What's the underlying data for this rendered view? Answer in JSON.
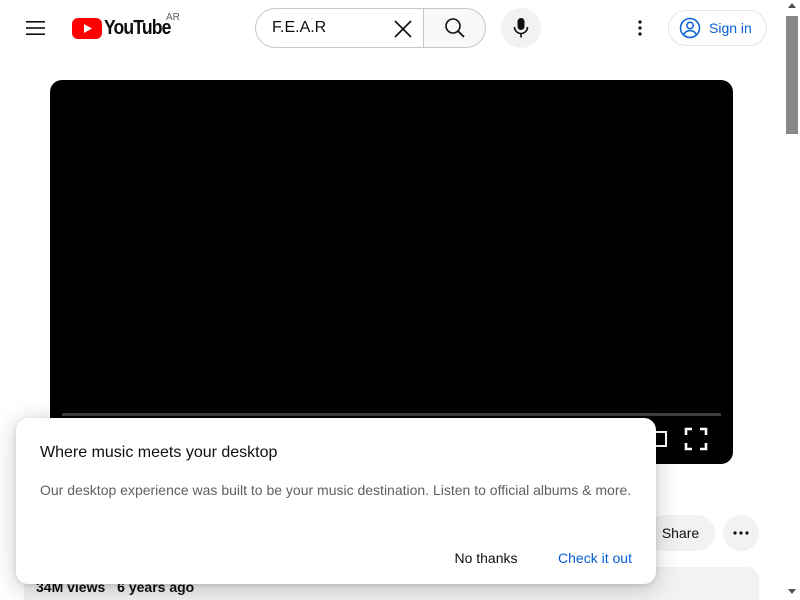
{
  "header": {
    "logo_text": "YouTube",
    "region_code": "AR",
    "search": {
      "value": "F.E.A.R",
      "placeholder": "Search"
    },
    "sign_in_label": "Sign in",
    "icons": {
      "menu": "hamburger-menu-icon",
      "clear": "close-icon",
      "search": "search-icon",
      "mic": "microphone-icon",
      "more": "more-vert-icon",
      "account": "account-circle-icon"
    }
  },
  "video": {
    "icons": {
      "theater": "theater-mode-icon",
      "fullscreen": "fullscreen-icon"
    }
  },
  "actions": {
    "share_label": "Share"
  },
  "description": {
    "views": "34M views",
    "age": "6 years ago"
  },
  "dialog": {
    "title": "Where music meets your desktop",
    "body": "Our desktop experience was built to be your music destination. Listen to official albums & more.",
    "dismiss_label": "No thanks",
    "confirm_label": "Check it out"
  },
  "colors": {
    "brand_red": "#ff0000",
    "link_blue": "#065fd4",
    "text_primary": "#0f0f0f",
    "text_secondary": "#606060",
    "chip_bg": "#f2f2f2"
  }
}
